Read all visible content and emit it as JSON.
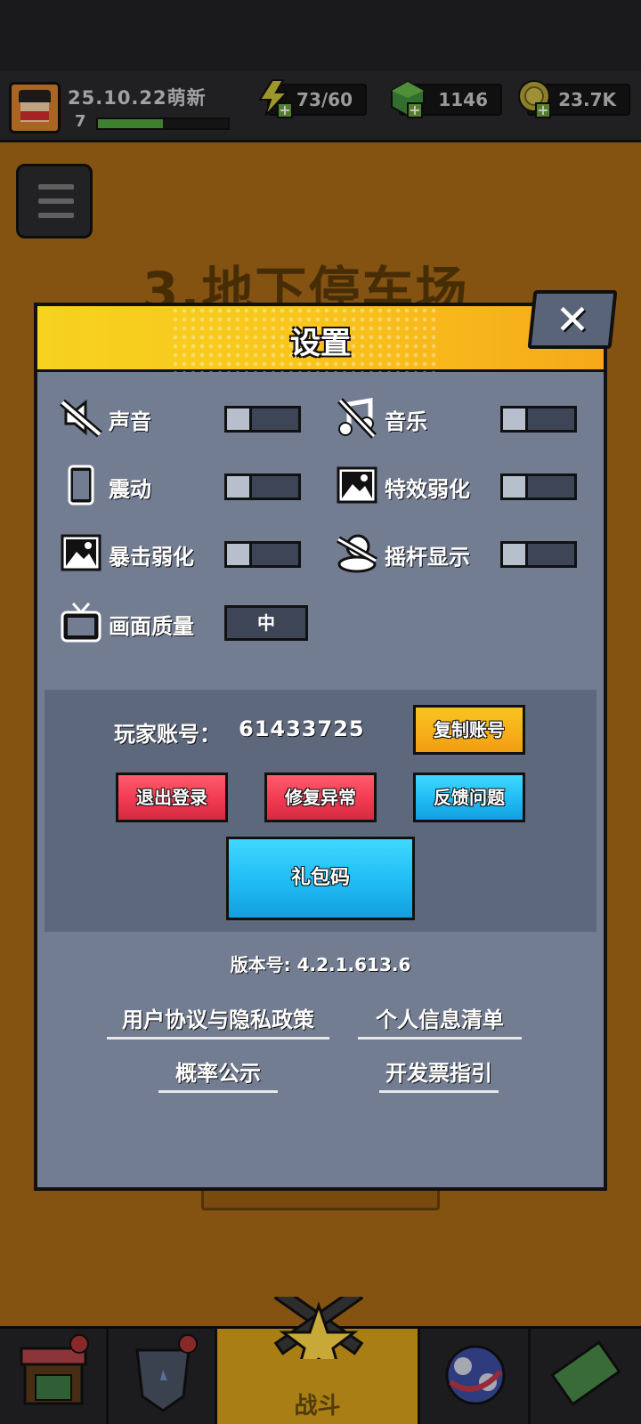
{
  "topbar": {
    "player_name": "25.10.22萌新",
    "level": "7",
    "xp_fraction": 0.5,
    "energy": "73/60",
    "gems": "1146",
    "coins": "23.7K"
  },
  "background": {
    "level_title": "3.地下停车场"
  },
  "bottom_nav": {
    "battle_label": "战斗"
  },
  "settings": {
    "title": "设置",
    "close_label": "✕",
    "items": [
      {
        "label": "声音",
        "icon": "sound-muted-icon",
        "on": false
      },
      {
        "label": "音乐",
        "icon": "music-muted-icon",
        "on": false
      },
      {
        "label": "震动",
        "icon": "phone-vibrate-icon",
        "on": false
      },
      {
        "label": "特效弱化",
        "icon": "image-icon",
        "on": false
      },
      {
        "label": "暴击弱化",
        "icon": "image-icon",
        "on": false
      },
      {
        "label": "摇杆显示",
        "icon": "joystick-icon",
        "on": false
      }
    ],
    "quality_label": "画面质量",
    "quality_value": "中"
  },
  "account": {
    "label": "玩家账号：",
    "id": "61433725",
    "copy_button": "复制账号",
    "logout_button": "退出登录",
    "repair_button": "修复异常",
    "feedback_button": "反馈问题",
    "gift_code_button": "礼包码"
  },
  "footer": {
    "version": "版本号: 4.2.1.613.6",
    "links": [
      "用户协议与隐私政策",
      "个人信息清单",
      "概率公示",
      "开发票指引"
    ]
  },
  "colors": {
    "modal_bg": "#737d92",
    "header_yellow": "#f7d21f",
    "button_red": "#f13b52",
    "button_blue": "#1fbcf4",
    "button_yellow": "#f7b01a"
  }
}
